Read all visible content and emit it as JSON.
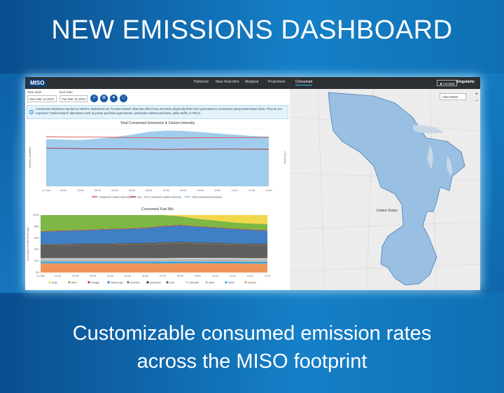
{
  "banner": {
    "headline": "NEW EMISSIONS DASHBOARD",
    "caption_line1": "Customizable consumed emission rates",
    "caption_line2": "across the MISO footprint"
  },
  "app": {
    "logo": "MISO",
    "nav": [
      "Historical",
      "Near Real-time",
      "Marginal",
      "Projections",
      "Consumed"
    ],
    "active_nav": "Consumed",
    "account_label": "Account",
    "partner_brand": "Singularity",
    "start_date_label": "Start Date",
    "start_date_value": "Mon Mar 14 2022",
    "end_date_label": "End Date",
    "end_date_value": "Tue Mar 15 2022",
    "notice": "Consumed emissions reported on MISO's dashboard are \"location-based\" data that reflect how electricity physically flows from generators to consumers along transmission lines. They do not represent \"market-based\" allocations such as power purchase agreements, wholesale market purchases, utility tariffs, or RECs.",
    "view_select": "View MISO",
    "map_label": "United States"
  },
  "colors": {
    "accent": "#41b6e6",
    "brand_blue": "#1a5aa6",
    "area_fill": "#8fc3ea",
    "line_red": "#d9534f"
  },
  "chart_data": [
    {
      "type": "area",
      "title": "Total Consumed Emissions & Carbon Intensity",
      "ylabel_left": "Intensity (lbs/MWh)",
      "ylabel_right": "CO2 (tons)",
      "x": [
        "14. Mar",
        "01:00",
        "02:00",
        "03:00",
        "04:00",
        "05:00",
        "06:00",
        "07:00",
        "08:00",
        "09:00",
        "10:00",
        "11:00",
        "12:00",
        "13:00"
      ],
      "series": [
        {
          "name": "Total Consumed Emissions",
          "kind": "area",
          "values": [
            1150,
            1140,
            1130,
            1160,
            1200,
            1260,
            1330,
            1360,
            1350,
            1320,
            1290,
            1260,
            1230,
            1210
          ]
        },
        {
          "name": "Consumed Carbon Intensity",
          "kind": "line",
          "values": [
            1210,
            1205,
            1200,
            1200,
            1195,
            1190,
            1185,
            1180,
            1180,
            1185,
            1185,
            1190,
            1190,
            1195
          ]
        },
        {
          "name": "Non - CFE Consumed Carbon Intensity",
          "kind": "line",
          "values": [
            930,
            925,
            920,
            915,
            915,
            910,
            905,
            900,
            905,
            905,
            910,
            910,
            905,
            905
          ]
        }
      ],
      "ylim": [
        0,
        1400
      ]
    },
    {
      "type": "area",
      "title": "Consumed Fuel Mix",
      "ylabel": "Consumed Fuel Mix Percentage",
      "x": [
        "14. Mar",
        "01:00",
        "02:00",
        "03:00",
        "04:00",
        "05:00",
        "06:00",
        "07:00",
        "08:00",
        "09:00",
        "10:00",
        "11:00",
        "12:00",
        "13:00"
      ],
      "yticks": [
        "0%",
        "20%",
        "40%",
        "60%",
        "80%",
        "100%"
      ],
      "series": [
        {
          "name": "nuclear",
          "color": "#f0955a",
          "values": [
            16,
            16,
            16,
            16,
            16,
            16,
            16,
            15,
            15,
            15,
            15,
            15,
            15,
            15
          ]
        },
        {
          "name": "hydro",
          "color": "#3aa6dc",
          "values": [
            3,
            3,
            3,
            3,
            3,
            3,
            3,
            3,
            3,
            3,
            3,
            3,
            3,
            3
          ]
        },
        {
          "name": "other",
          "color": "#b8b8b8",
          "values": [
            4,
            4,
            4,
            4,
            4,
            4,
            4,
            4,
            4,
            4,
            4,
            4,
            4,
            4
          ]
        },
        {
          "name": "unknown",
          "color": "#d0d0d0",
          "values": [
            2,
            2,
            2,
            2,
            2,
            2,
            2,
            2,
            2,
            2,
            2,
            2,
            2,
            2
          ]
        },
        {
          "name": "coal",
          "color": "#5e5e5e",
          "values": [
            22,
            22,
            23,
            23,
            23,
            24,
            24,
            24,
            24,
            23,
            23,
            22,
            22,
            22
          ]
        },
        {
          "name": "biomass",
          "color": "#8a6d3b",
          "values": [
            1,
            1,
            1,
            1,
            1,
            1,
            1,
            1,
            1,
            1,
            1,
            1,
            1,
            1
          ]
        },
        {
          "name": "petroleum",
          "color": "#333333",
          "values": [
            1,
            1,
            1,
            1,
            1,
            1,
            1,
            1,
            1,
            1,
            1,
            1,
            1,
            1
          ]
        },
        {
          "name": "natural gas",
          "color": "#3f7fc4",
          "values": [
            22,
            23,
            23,
            24,
            25,
            25,
            26,
            27,
            27,
            26,
            25,
            24,
            23,
            22
          ]
        },
        {
          "name": "storage",
          "color": "#c0392b",
          "values": [
            1,
            1,
            1,
            1,
            1,
            1,
            1,
            1,
            1,
            1,
            1,
            1,
            1,
            1
          ]
        },
        {
          "name": "wind",
          "color": "#7cb843",
          "values": [
            28,
            27,
            26,
            25,
            24,
            23,
            22,
            18,
            14,
            12,
            11,
            10,
            10,
            10
          ]
        },
        {
          "name": "solar",
          "color": "#f2d74a",
          "values": [
            0,
            0,
            0,
            0,
            0,
            0,
            0,
            0,
            2,
            6,
            9,
            12,
            14,
            15
          ]
        }
      ]
    }
  ]
}
